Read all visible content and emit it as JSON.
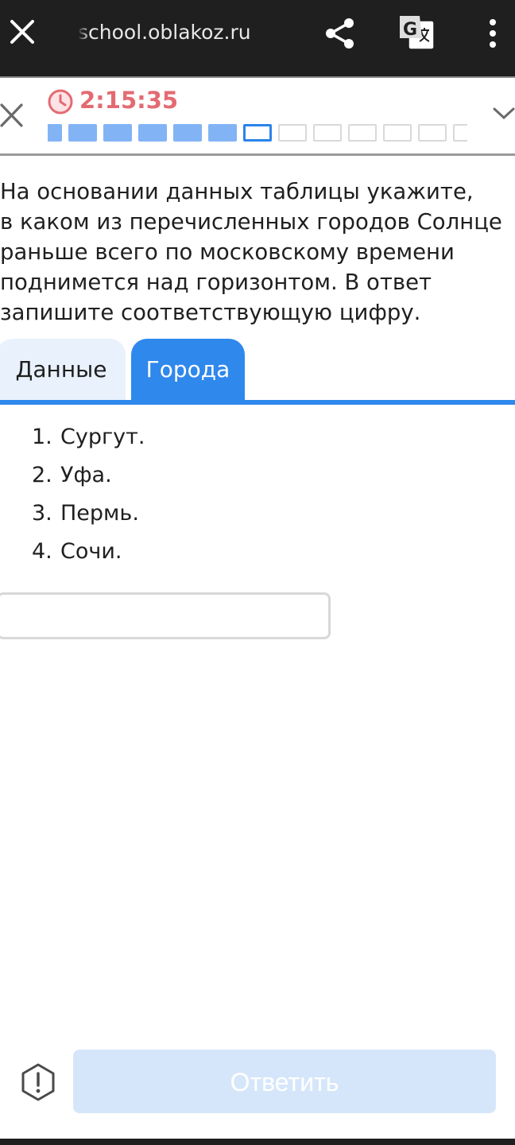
{
  "browser": {
    "url": "school.oblakoz.ru"
  },
  "test": {
    "timer": "2:15:35",
    "progress": {
      "completed": 6,
      "current": 7,
      "visible_total": 13
    }
  },
  "question": {
    "lines": [
      "На основании данных таблицы укажите,",
      "в каком из перечисленных городов Солнце",
      "раньше всего по московскому времени",
      "поднимется над горизонтом. В ответ",
      "запишите соответствующую цифру."
    ]
  },
  "tabs": [
    {
      "label": "Данные",
      "active": false
    },
    {
      "label": "Города",
      "active": true
    }
  ],
  "cities": [
    {
      "num": "1.",
      "name": "Сургут."
    },
    {
      "num": "2.",
      "name": "Уфа."
    },
    {
      "num": "3.",
      "name": "Пермь."
    },
    {
      "num": "4.",
      "name": "Сочи."
    }
  ],
  "answer": {
    "value": "",
    "submit_label": "Ответить"
  },
  "colors": {
    "accent": "#2f88ec",
    "timer": "#e46a72",
    "progress_done": "#82b4f5",
    "submit_disabled": "#d6e6fa"
  }
}
